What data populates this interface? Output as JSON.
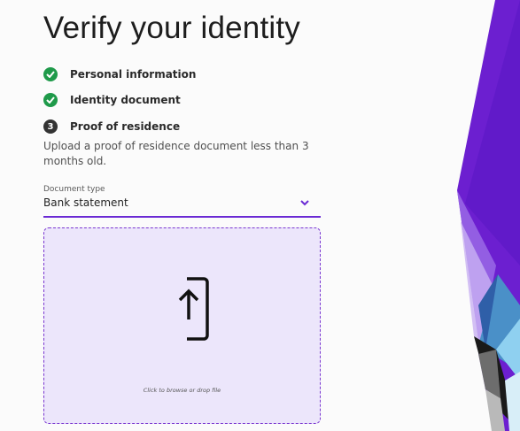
{
  "page": {
    "title": "Verify your identity"
  },
  "steps": [
    {
      "label": "Personal information",
      "status": "complete",
      "icon": "check-icon"
    },
    {
      "label": "Identity document",
      "status": "complete",
      "icon": "check-icon"
    },
    {
      "label": "Proof of residence",
      "status": "current",
      "number": "3"
    }
  ],
  "current_step": {
    "description": "Upload a proof of residence document less than 3 months old."
  },
  "document_type": {
    "label": "Document type",
    "value": "Bank statement",
    "icon": "chevron-down-icon"
  },
  "upload": {
    "hint": "Click to browse or drop file",
    "icon": "upload-phone-icon"
  },
  "colors": {
    "accent": "#6a2ad4",
    "success": "#1f9a4a",
    "dropzone_bg": "#ece6fb"
  }
}
